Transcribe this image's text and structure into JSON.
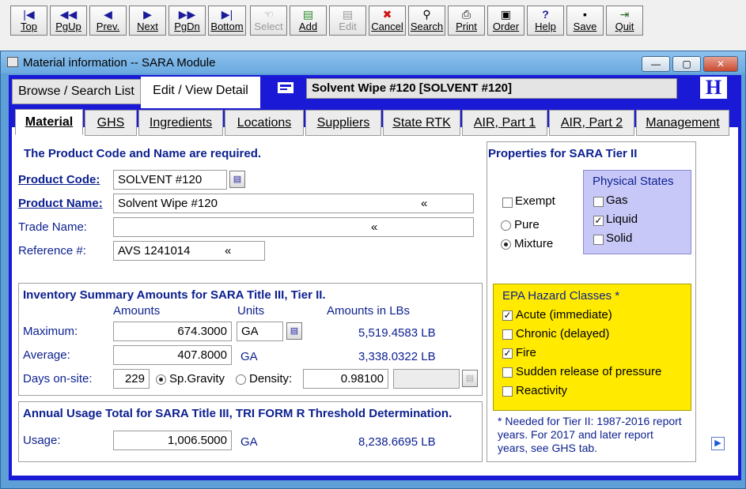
{
  "toolbar": {
    "buttons": [
      {
        "label": "Top",
        "icon": "|◀"
      },
      {
        "label": "PgUp",
        "icon": "◀◀"
      },
      {
        "label": "Prev.",
        "icon": "◀"
      },
      {
        "label": "Next",
        "icon": "▶"
      },
      {
        "label": "PgDn",
        "icon": "▶▶"
      },
      {
        "label": "Bottom",
        "icon": "▶|"
      },
      {
        "label": "Select",
        "icon": "☜"
      },
      {
        "label": "Add",
        "icon": "▤"
      },
      {
        "label": "Edit",
        "icon": "▤"
      },
      {
        "label": "Cancel",
        "icon": "✖"
      },
      {
        "label": "Search",
        "icon": "⚲"
      },
      {
        "label": "Print",
        "icon": "⎙"
      },
      {
        "label": "Order",
        "icon": "▣"
      },
      {
        "label": "Help",
        "icon": "?"
      },
      {
        "label": "Save",
        "icon": "▪"
      },
      {
        "label": "Quit",
        "icon": "⇥"
      }
    ]
  },
  "window": {
    "title": "Material information -- SARA Module",
    "min": "—",
    "max": "▢",
    "close": "✕"
  },
  "view_tabs": {
    "browse": "Browse / Search List",
    "edit": "Edit / View Detail"
  },
  "record_title": "Solvent Wipe #120 [SOLVENT #120]",
  "logo": "H",
  "tabs": [
    "Material",
    "GHS",
    "Ingredients",
    "Locations",
    "Suppliers",
    "State RTK",
    "AIR, Part 1",
    "AIR, Part 2",
    "Management"
  ],
  "material": {
    "required_note": "The Product Code and Name are required.",
    "product_code_label": "Product Code:",
    "product_code": "SOLVENT #120",
    "product_name_label": "Product Name:",
    "product_name": "Solvent Wipe #120",
    "trade_name_label": "Trade Name:",
    "trade_name": "",
    "reference_label": "Reference #:",
    "reference": "AVS 1241014",
    "expand_glyph": "«"
  },
  "inventory": {
    "title": "Inventory Summary Amounts for SARA Title III, Tier II.",
    "col_amounts": "Amounts",
    "col_units": "Units",
    "col_lbs": "Amounts in LBs",
    "max_label": "Maximum:",
    "max_amount": "674.3000",
    "max_units": "GA",
    "max_lbs": "5,519.4583 LB",
    "avg_label": "Average:",
    "avg_amount": "407.8000",
    "avg_units": "GA",
    "avg_lbs": "3,338.0322 LB",
    "days_label": "Days on-site:",
    "days": "229",
    "sp_gravity_label": "Sp.Gravity",
    "density_label": "Density:",
    "density_value": "0.98100"
  },
  "usage": {
    "title": "Annual Usage Total for SARA Title III, TRI FORM R Threshold Determination.",
    "label": "Usage:",
    "amount": "1,006.5000",
    "units": "GA",
    "lbs": "8,238.6695 LB"
  },
  "tier2": {
    "title": "Properties for SARA Tier II",
    "exempt": "Exempt",
    "pure": "Pure",
    "mixture": "Mixture",
    "physical_title": "Physical States",
    "gas": "Gas",
    "liquid": "Liquid",
    "solid": "Solid",
    "hazard_title": "EPA Hazard Classes *",
    "acute": "Acute (immediate)",
    "chronic": "Chronic (delayed)",
    "fire": "Fire",
    "sudden": "Sudden release of pressure",
    "reactivity": "Reactivity",
    "note": "* Needed for Tier II: 1987-2016 report years. For 2017 and later report years, see GHS tab.",
    "check": "✓"
  },
  "next_arrow": "▶"
}
